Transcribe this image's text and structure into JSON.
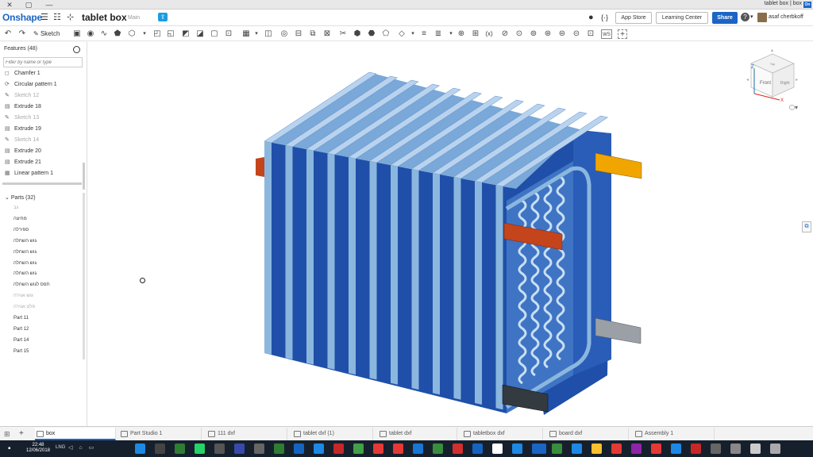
{
  "window": {
    "close": "✕",
    "restore": "▢",
    "minimize": "—",
    "title": "tablet box | box",
    "title_badge": "On"
  },
  "header": {
    "logo": "Onshape",
    "doc_title": "tablet box",
    "branch": "Main",
    "app_store": "App Store",
    "learning_center": "Learning Center",
    "share": "Share",
    "help": "?",
    "user": "asaf cherbkoff"
  },
  "toolbar": {
    "sketch": "Sketch",
    "ws_label": "WS"
  },
  "features": {
    "title": "Features (48)",
    "filter_placeholder": "Filter by name or type",
    "items": [
      {
        "label": "Chamfer 1",
        "icon": "◻",
        "dim": false
      },
      {
        "label": "Circular pattern 1",
        "icon": "⟳",
        "dim": false
      },
      {
        "label": "Sketch 12",
        "icon": "✎",
        "dim": true
      },
      {
        "label": "Extrude 18",
        "icon": "▤",
        "dim": false
      },
      {
        "label": "Sketch 13",
        "icon": "✎",
        "dim": true
      },
      {
        "label": "Extrude 19",
        "icon": "▤",
        "dim": false
      },
      {
        "label": "Sketch 14",
        "icon": "✎",
        "dim": true
      },
      {
        "label": "Extrude 20",
        "icon": "▤",
        "dim": false
      },
      {
        "label": "Extrude 21",
        "icon": "▤",
        "dim": false
      },
      {
        "label": "Linear pattern 1",
        "icon": "▦",
        "dim": false
      }
    ]
  },
  "parts": {
    "title": "Parts (32)",
    "items": [
      {
        "label": "גב",
        "dim": true
      },
      {
        "label": "מחיצה",
        "dim": false
      },
      {
        "label": "ספירלה",
        "dim": false
      },
      {
        "label": "גוש השחלה",
        "dim": false
      },
      {
        "label": "גוש השחלה",
        "dim": false
      },
      {
        "label": "גוש השחלה",
        "dim": false
      },
      {
        "label": "גוש השחלה",
        "dim": false
      },
      {
        "label": "תפס לגוש השחלה",
        "dim": false
      },
      {
        "label": "גוש אגירה",
        "dim": true
      },
      {
        "label": "פלט אגירה",
        "dim": true
      },
      {
        "label": "Part 11",
        "dim": false
      },
      {
        "label": "Part 12",
        "dim": false
      },
      {
        "label": "Part 14",
        "dim": false
      },
      {
        "label": "Part 15",
        "dim": false
      }
    ]
  },
  "viewcube": {
    "front": "Front",
    "right": "Right",
    "top": "Top",
    "axis_x": "X",
    "axis_z": "Z"
  },
  "tabs": [
    {
      "label": "box",
      "active": true
    },
    {
      "label": "Part Studio 1",
      "active": false
    },
    {
      "label": "111 dxf",
      "active": false
    },
    {
      "label": "tablet dxf (1)",
      "active": false
    },
    {
      "label": "tablet dxf",
      "active": false
    },
    {
      "label": "tabletbox dxf",
      "active": false
    },
    {
      "label": "board dxf",
      "active": false
    },
    {
      "label": "Assembly 1",
      "active": false
    }
  ],
  "taskbar": {
    "time": "22:48",
    "date": "12/06/2018",
    "lang": "LNG"
  },
  "colors": {
    "brand_blue": "#1b65c4",
    "model_dark_blue": "#1f4fa8",
    "model_light_blue": "#8bb7df",
    "orange_peg": "#f0a500",
    "red_peg": "#c4441c",
    "gray_peg": "#9aa0a6",
    "black_peg": "#333a40"
  }
}
